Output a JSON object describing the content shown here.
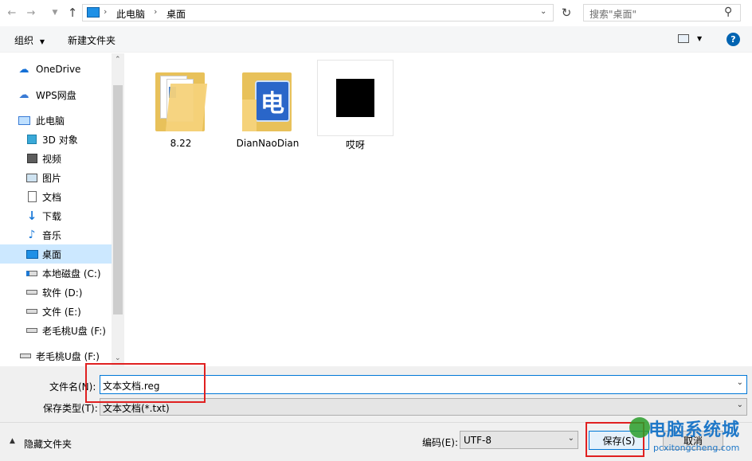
{
  "address_bar": {
    "crumbs": [
      "此电脑",
      "桌面"
    ]
  },
  "search": {
    "placeholder": "搜索\"桌面\""
  },
  "command_bar": {
    "organize": "组织",
    "new_folder": "新建文件夹"
  },
  "sidebar": {
    "items": [
      {
        "label": "OneDrive",
        "icon": "cloud-icon"
      },
      {
        "label": "WPS网盘",
        "icon": "cloud-outline-icon"
      },
      {
        "label": "此电脑",
        "icon": "computer-icon"
      },
      {
        "label": "3D 对象",
        "icon": "cube-icon"
      },
      {
        "label": "视频",
        "icon": "video-icon"
      },
      {
        "label": "图片",
        "icon": "picture-icon"
      },
      {
        "label": "文档",
        "icon": "document-icon"
      },
      {
        "label": "下载",
        "icon": "download-icon"
      },
      {
        "label": "音乐",
        "icon": "music-icon"
      },
      {
        "label": "桌面",
        "icon": "desktop-icon",
        "selected": true
      },
      {
        "label": "本地磁盘 (C:)",
        "icon": "drive-c-icon"
      },
      {
        "label": "软件 (D:)",
        "icon": "drive-icon"
      },
      {
        "label": "文件 (E:)",
        "icon": "drive-icon"
      },
      {
        "label": "老毛桃U盘 (F:)",
        "icon": "usb-drive-icon"
      },
      {
        "label": "老毛桃U盘 (F:)",
        "icon": "usb-drive-icon"
      }
    ]
  },
  "files": [
    {
      "name": "8.22",
      "icon": "folder-icon"
    },
    {
      "name": "DianNaoDian",
      "icon": "folder-app-icon"
    },
    {
      "name": "哎呀",
      "icon": "black-image-icon"
    }
  ],
  "folder_badge_char": "电",
  "bottom": {
    "filename_label": "文件名(N):",
    "filename_value": "文本文档.reg",
    "filetype_label": "保存类型(T):",
    "filetype_value": "文本文档(*.txt)",
    "hide_folders": "隐藏文件夹",
    "encoding_label": "编码(E):",
    "encoding_value": "UTF-8",
    "save_button": "保存(S)",
    "cancel_button": "取消"
  },
  "watermark": {
    "text": "电脑系统城",
    "url": "pcxitongcheng.com"
  },
  "colors": {
    "selection": "#cce8ff",
    "highlight_box": "#e02020",
    "help": "#0063b1",
    "folder": "#f5d27a"
  }
}
